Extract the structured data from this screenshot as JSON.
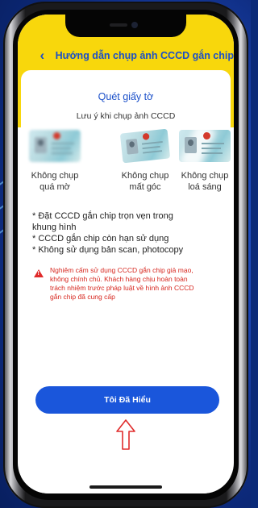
{
  "header": {
    "back_icon": "chevron-left-icon",
    "title": "Hướng dẫn chụp ảnh CCCD gắn chip"
  },
  "content": {
    "section_title": "Quét giấy tờ",
    "notice": "Lưu ý khi chụp ảnh CCCD",
    "samples": [
      {
        "line1": "Không chụp",
        "line2": "quá mờ"
      },
      {
        "line1": "Không chụp",
        "line2": "mất góc"
      },
      {
        "line1": "Không chụp",
        "line2": "loá sáng"
      }
    ],
    "rules": [
      "* Đặt CCCD gắn chip trọn vẹn trong",
      "khung hình",
      "* CCCD gắn chip còn hạn sử dụng",
      "* Không sử dụng bản scan, photocopy"
    ],
    "warning_lines": [
      "Nghiêm cấm sử dụng CCCD gắn chip giả mạo,",
      "không chính chủ. Khách hàng chịu hoàn toàn",
      "trách nhiệm trước pháp luật về hình ảnh CCCD",
      "gắn chip đã cung cấp"
    ],
    "confirm_button": "Tôi Đã Hiểu"
  },
  "colors": {
    "header_bg": "#f8d70c",
    "primary": "#1a56db",
    "warning": "#d7261e"
  }
}
